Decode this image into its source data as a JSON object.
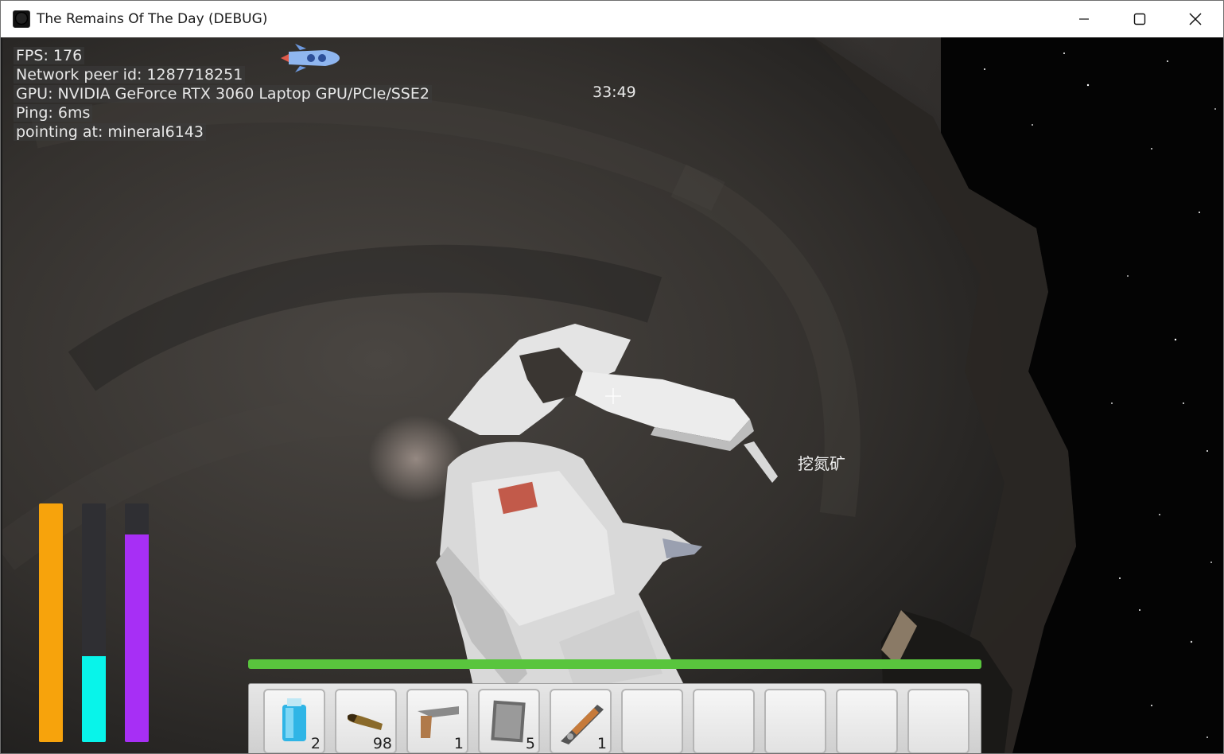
{
  "window": {
    "title": "The Remains Of The Day (DEBUG)",
    "controls": [
      "minimize-icon",
      "maximize-icon",
      "close-icon"
    ]
  },
  "debug": {
    "fps": "FPS: 176",
    "peer": "Network peer id: 1287718251",
    "gpu": "GPU: NVIDIA GeForce RTX 3060 Laptop GPU/PCIe/SSE2",
    "ping": "Ping: 6ms",
    "pointing": "pointing at: mineral6143"
  },
  "hud": {
    "timer": "33:49",
    "action_prompt": "挖氮矿",
    "status_bars": [
      {
        "name": "bar-orange",
        "color": "#f7a30c",
        "level": 1.0
      },
      {
        "name": "bar-cyan",
        "color": "#08f4ea",
        "level": 0.36
      },
      {
        "name": "bar-purple",
        "color": "#a72ff5",
        "level": 0.87
      }
    ],
    "health_bar": {
      "color": "#59c53d",
      "level": 1.0
    }
  },
  "hotbar": {
    "slots": [
      {
        "item": "oxygen-tank-icon",
        "count": "2"
      },
      {
        "item": "bullet-icon",
        "count": "98"
      },
      {
        "item": "pistol-icon",
        "count": "1"
      },
      {
        "item": "metal-plate-icon",
        "count": "5"
      },
      {
        "item": "mining-drill-icon",
        "count": "1"
      },
      {
        "item": "",
        "count": ""
      },
      {
        "item": "",
        "count": ""
      },
      {
        "item": "",
        "count": ""
      },
      {
        "item": "",
        "count": ""
      },
      {
        "item": "",
        "count": ""
      }
    ]
  }
}
